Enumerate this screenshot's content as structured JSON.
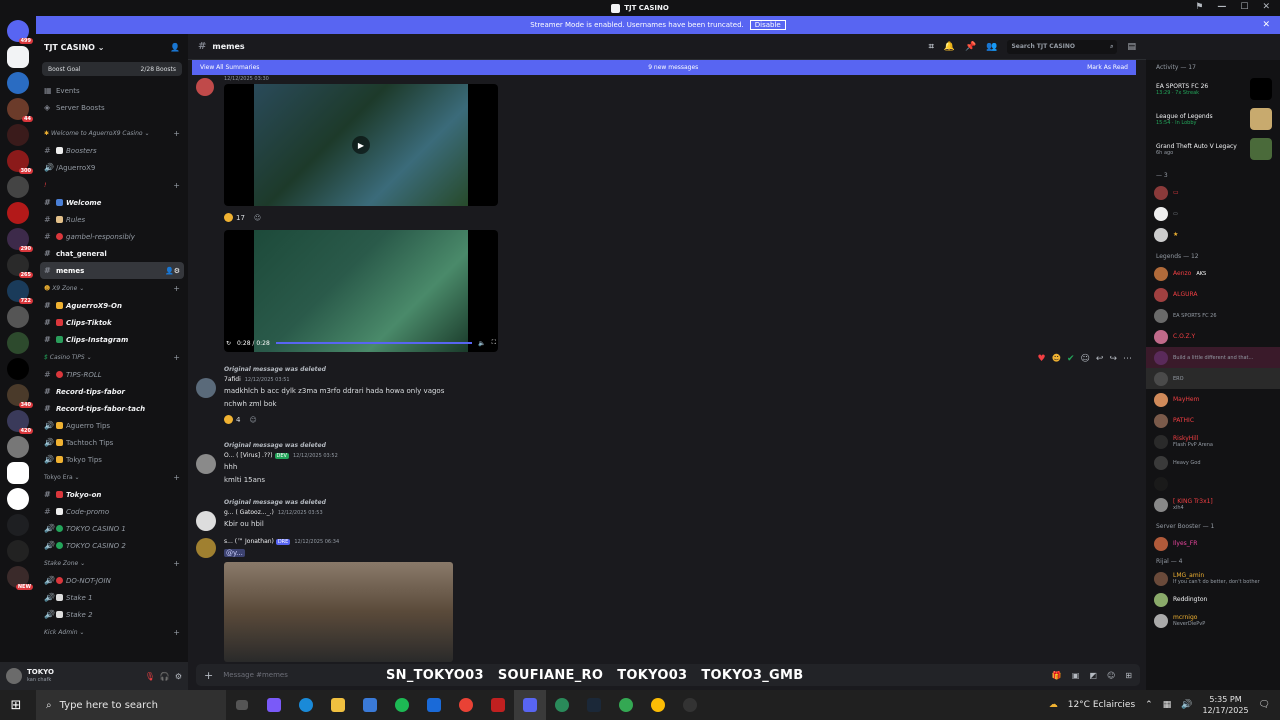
{
  "window": {
    "title": "TJT CASINO"
  },
  "banner": {
    "text": "Streamer Mode is enabled. Usernames have been truncated.",
    "button": "Disable"
  },
  "server_badges": [
    "499",
    "44",
    "300",
    "290",
    "265",
    "722",
    "340",
    "420",
    "NEW"
  ],
  "guild": {
    "name": "TJT CASINO",
    "boost_label": "Boost Goal",
    "boost_count": "2/28 Boosts",
    "top_items": [
      "Events",
      "Server Boosts"
    ]
  },
  "categories": {
    "welcome": "Welcome to AguerroX9 Casino",
    "x9zone": "X9 Zone",
    "casino_tips": "Casino TIPS",
    "tokyo_era": "Tokyo Era",
    "stake_zone": "Stake Zone",
    "kick_admin": "Kick Admin"
  },
  "channels": {
    "boosters": "Boosters",
    "aguerro": "/AguerroX9",
    "bang": "!",
    "welcome": "Welcome",
    "rules": "Rules",
    "gambel": "gambel-responsibly",
    "chat_general": "chat_general",
    "memes": "memes",
    "aguerrox9_on": "AguerroX9-On",
    "clips_tiktok": "Clips-Tiktok",
    "clips_instagram": "Clips-Instagram",
    "tips_roll": "TIPS-ROLL",
    "record_fabor": "Record-tips-fabor",
    "record_tach": "Record-tips-fabor-tach",
    "aguerro_tips": "Aguerro Tips",
    "tachtoch_tips": "Tachtoch Tips",
    "tokyo_tips": "Tokyo Tips",
    "tokyo_on": "Tokyo-on",
    "code_promo": "Code-promo",
    "tokyo_casino1": "TOKYO CASINO 1",
    "tokyo_casino2": "TOKYO CASINO 2",
    "do_not_join": "DO-NOT-JOIN",
    "stake1": "Stake 1",
    "stake2": "Stake 2"
  },
  "user": {
    "name": "TOKYO",
    "status": "kan chafk"
  },
  "channel_header": {
    "name": "memes",
    "search_placeholder": "Search TJT CASINO"
  },
  "summary_bar": {
    "left": "View All Summaries",
    "center": "9 new messages",
    "right": "Mark As Read"
  },
  "video1": {
    "timestamp": "12/12/2025 03:30",
    "reaction_count": "17"
  },
  "video2": {
    "time": "0:28 / 0:28"
  },
  "messages": [
    {
      "reply": "Original message was deleted",
      "author": "7afidi",
      "timestamp": "12/12/2025 03:51",
      "lines": [
        "madkhlch b acc dylk z3ma m3rfo ddrari hada howa only vagos",
        "nchwh zml bok"
      ],
      "reaction_count": "4"
    },
    {
      "reply": "Original message was deleted",
      "author": "O... ( [Virus] .??)",
      "tag": "DEV",
      "timestamp": "12/12/2025 03:52",
      "lines": [
        "hhh",
        "kmlti 15ans"
      ]
    },
    {
      "reply": "Original message was deleted",
      "author": "g... (  Gatooz..._.)",
      "timestamp": "12/12/2025 03:53",
      "lines": [
        "Kbir ou hbil"
      ]
    },
    {
      "author": "s... (™ Jonathan)",
      "tag": "DRE",
      "timestamp": "12/12/2025 06:34",
      "lines": [
        "@y..."
      ]
    }
  ],
  "composer": {
    "placeholder": "Message #memes"
  },
  "socials": [
    "SN_TOKYO03",
    "SOUFIANE_RO",
    "TOKYO03",
    "TOKYO3_GMB"
  ],
  "activity": {
    "title": "Activity — 17",
    "items": [
      {
        "game": "EA SPORTS FC 26",
        "sub": "13:29 · 7x Streak"
      },
      {
        "game": "League of Legends",
        "sub": "15:54 · In Lobby"
      },
      {
        "game": "Grand Theft Auto V Legacy",
        "sub": "6h ago"
      }
    ]
  },
  "member_sections": {
    "s1": "— 3",
    "legends": "Legends — 12",
    "server_booster": "Server Booster — 1",
    "rijal": "Rijal — 4"
  },
  "members": [
    {
      "name": "Aenzo",
      "sub": "AKS"
    },
    {
      "name": "ALGURA",
      "sub": ""
    },
    {
      "name": "",
      "sub": "EA SPORTS FC 26"
    },
    {
      "name": "C.O.Z.Y",
      "sub": ""
    },
    {
      "name": "",
      "sub": "Build a little different and that..."
    },
    {
      "name": "",
      "sub": "ERO"
    },
    {
      "name": "MayHem",
      "sub": ""
    },
    {
      "name": "PATHIC",
      "sub": ""
    },
    {
      "name": "RiskyHill",
      "sub": "Flash PvP Arena"
    },
    {
      "name": "",
      "sub": "Heavy God"
    },
    {
      "name": "",
      "sub": ""
    },
    {
      "name": "[ KING Tr3x1]",
      "sub": "xlh4"
    },
    {
      "name": "Ilyes_FR",
      "sub": ""
    },
    {
      "name": "LMG_amin",
      "sub": "If you can't do better, don't bother"
    },
    {
      "name": "Reddington",
      "sub": ""
    },
    {
      "name": "mcrnigo",
      "sub": "NeverDiePvP"
    }
  ],
  "taskbar": {
    "search_placeholder": "Type here to search",
    "weather": "12°C  Eclaircies",
    "time": "5:35 PM",
    "date": "12/17/2025"
  },
  "colors": {
    "blurple": "#5865f2",
    "online": "#23a55a",
    "danger": "#f23f43"
  }
}
